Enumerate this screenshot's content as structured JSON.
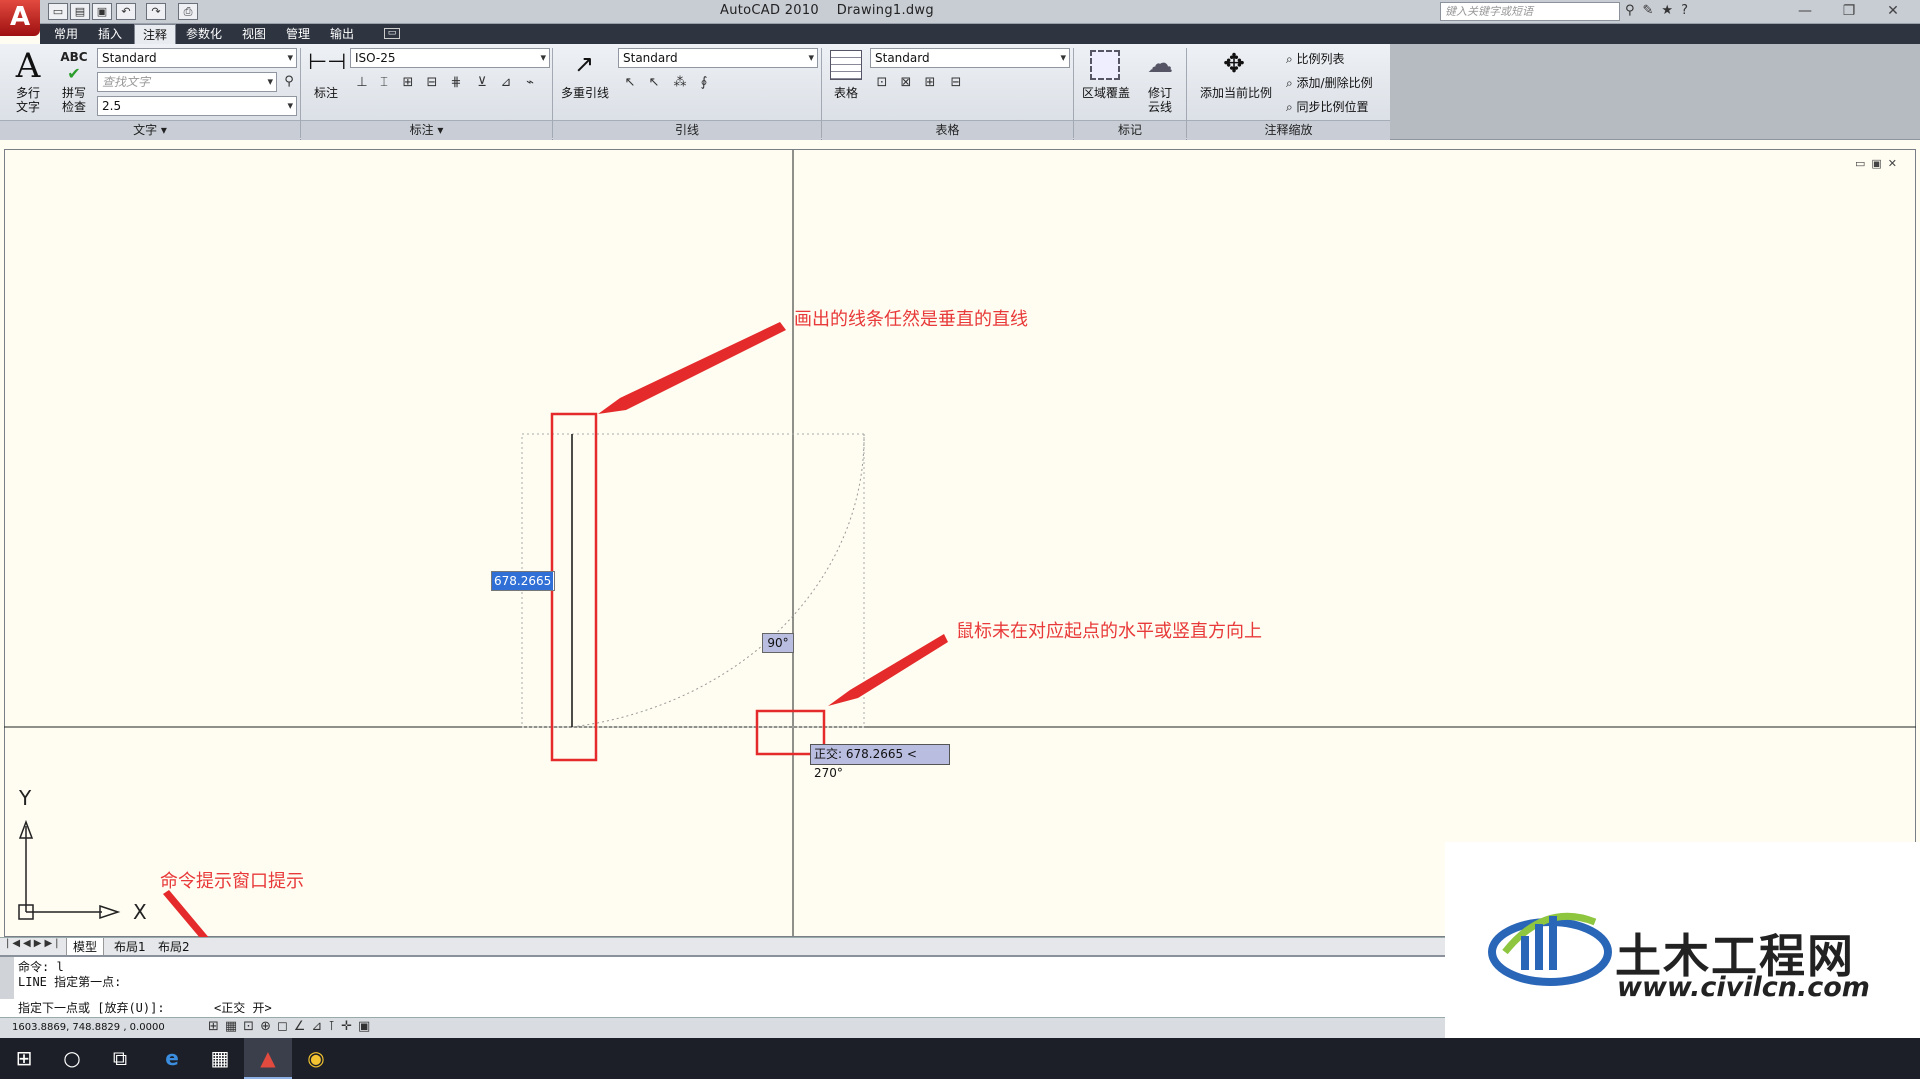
{
  "titlebar": {
    "logo_letter": "A",
    "app_title": "AutoCAD 2010",
    "file_title": "Drawing1.dwg",
    "search_placeholder": "键入关键字或短语",
    "min_glyph": "—",
    "restore_glyph": "❐",
    "close_glyph": "✕"
  },
  "tabs": [
    {
      "label": "常用"
    },
    {
      "label": "插入"
    },
    {
      "label": "注释"
    },
    {
      "label": "参数化"
    },
    {
      "label": "视图"
    },
    {
      "label": "管理"
    },
    {
      "label": "输出"
    }
  ],
  "ribbon": {
    "text_panel": {
      "multiline_text_label_1": "多行",
      "multiline_text_label_2": "文字",
      "spell_label_1": "拼写",
      "spell_label_2": "检查",
      "style_value": "Standard",
      "find_placeholder": "查找文字",
      "height_value": "2.5",
      "panel_title": "文字 ▾"
    },
    "dim_panel": {
      "dim_label": "标注",
      "style_value": "ISO-25",
      "panel_title": "标注 ▾"
    },
    "leader_panel": {
      "mleader_label": "多重引线",
      "style_value": "Standard",
      "panel_title": "引线"
    },
    "table_panel": {
      "table_label": "表格",
      "style_value": "Standard",
      "panel_title": "表格"
    },
    "markup_panel": {
      "wipeout_label": "区域覆盖",
      "revcloud_label_1": "修订",
      "revcloud_label_2": "云线",
      "panel_title": "标记"
    },
    "scale_panel": {
      "add_current_label": "添加当前比例",
      "scale_list": "比例列表",
      "add_delete_scale": "添加/删除比例",
      "sync_scale": "同步比例位置",
      "panel_title": "注释缩放"
    }
  },
  "drawing": {
    "dynamic_input_value": "678.2665",
    "angle_tooltip": "90°",
    "ortho_tooltip": "正交: 678.2665 < 270°",
    "ucs_y": "Y",
    "ucs_x": "X"
  },
  "annotations": {
    "a1": "画出的线条任然是垂直的直线",
    "a2": "鼠标未在对应起点的水平或竖直方向上",
    "a3": "命令提示窗口提示"
  },
  "layout_tabs": [
    {
      "label": "模型"
    },
    {
      "label": "布局1"
    },
    {
      "label": "布局2"
    }
  ],
  "command": {
    "line1": "命令: l",
    "line2": "LINE 指定第一点:",
    "prompt": "指定下一点或 [放弃(U)]:",
    "ortho_msg": "<正交 开>"
  },
  "status": {
    "coords": "1603.8869, 748.8829 , 0.0000"
  },
  "watermark": {
    "brand": "土木工程网",
    "url": "www.civilcn.com"
  },
  "colors": {
    "annotation_red": "#e83a3a",
    "drawing_bg": "#fffdf1",
    "ribbon_dark": "#2e3440"
  }
}
